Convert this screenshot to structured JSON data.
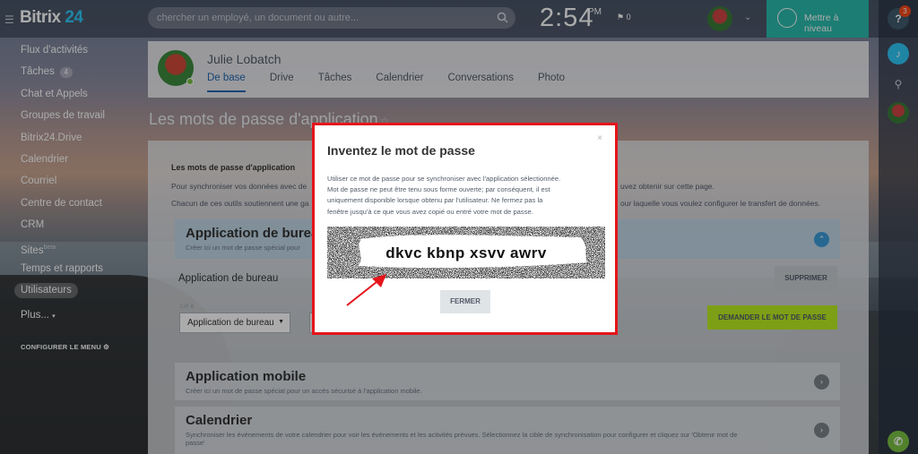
{
  "app": {
    "logo_text": "Bitrix",
    "logo_number": "24",
    "search_placeholder": "chercher un employé, un document ou autre...",
    "clock": "2:54",
    "clock_suffix": "PM",
    "flag_count": "0",
    "upgrade_label": "Mettre à niveau"
  },
  "rail": {
    "help_badge": "3"
  },
  "menu": {
    "items": [
      {
        "label": "Flux d'activités"
      },
      {
        "label": "Tâches",
        "count": "4"
      },
      {
        "label": "Chat et Appels"
      },
      {
        "label": "Groupes de travail"
      },
      {
        "label": "Bitrix24.Drive"
      },
      {
        "label": "Calendrier"
      },
      {
        "label": "Courriel"
      },
      {
        "label": "Centre de contact"
      },
      {
        "label": "CRM"
      },
      {
        "label": "Sites",
        "sup": "beta"
      },
      {
        "label": "Temps et rapports"
      },
      {
        "label": "Utilisateurs"
      },
      {
        "label": "Plus..."
      }
    ],
    "configure": "CONFIGURER LE MENU"
  },
  "profile": {
    "name": "Julie Lobatch",
    "tabs": [
      "De base",
      "Drive",
      "Tâches",
      "Calendrier",
      "Conversations",
      "Photo"
    ]
  },
  "page": {
    "title": "Les mots de passe d'application",
    "section_title": "Les mots de passe d'application",
    "para_left_1": "Pour synchroniser vos données avec de",
    "para_right_1": "uvez obtenir sur cette page.",
    "para_left_2": "Chacun de ces outils soutiennent une ga",
    "para_right_2": "our laquelle vous voulez configurer le transfert de données.",
    "desktop": {
      "title": "Application de burea",
      "subtitle": "Créer ici un mot de passe spécial pour",
      "label": "Application de bureau",
      "delete_btn": "SUPPRIMER",
      "select_label": "Lié à",
      "select_value": "Application de bureau",
      "request_btn": "DEMANDER LE MOT DE PASSE"
    },
    "mobile": {
      "title": "Application mobile",
      "subtitle": "Créer ici un mot de passe spécial pour un accès sécurisé à l'application mobile."
    },
    "calendar": {
      "title": "Calendrier",
      "subtitle_1": "Synchroniser les événements de votre calendrier pour voir les événements et les activités prévues. Sélectionnez la cible de synchronisation pour configurer et cliquez sur 'Obtenir mot de",
      "subtitle_2": "passe'"
    }
  },
  "modal": {
    "title": "Inventez le mot de passe",
    "close": "×",
    "text": [
      "Utiliser ce mot de passe pour se synchroniser avec l'application sélectionnée.",
      "Mot de passe ne peut être tenu sous forme ouverte; par conséquent, il est",
      "uniquement disponible lorsque obtenu par l'utilisateur. Ne fermez pas la",
      "fenêtre jusqu'à ce que vous avez copié ou entré votre mot de passe."
    ],
    "password": "dkvc kbnp xsvv awrv",
    "close_btn": "FERMER",
    "colors": {
      "border": "#e5141b",
      "arrow": "#e5141b"
    }
  }
}
